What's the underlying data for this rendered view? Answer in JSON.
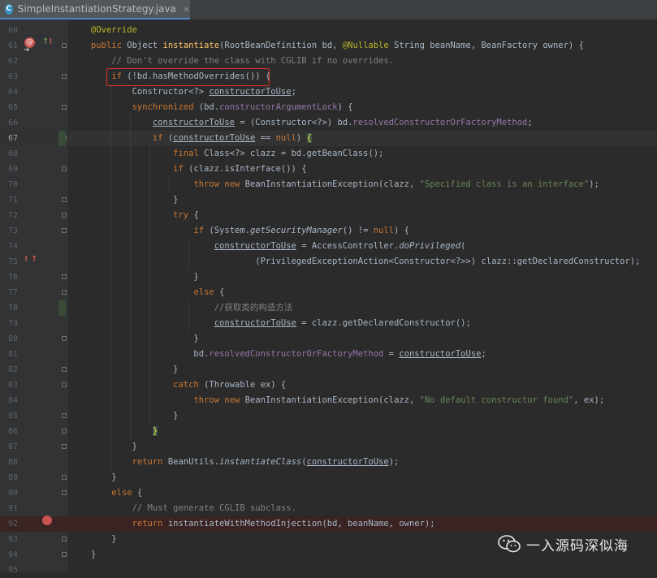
{
  "tab": {
    "icon_letter": "C",
    "file_name": "SimpleInstantiationStrategy.java",
    "close_glyph": "×"
  },
  "editor": {
    "caret_line": 67,
    "breakpoint_line": 92,
    "lines": [
      {
        "n": 60,
        "t": [
          {
            "c": "an",
            "v": "@Override"
          }
        ]
      },
      {
        "n": 61,
        "t": [
          {
            "c": "kw",
            "v": "public "
          },
          {
            "v": "Object "
          },
          {
            "c": "fn",
            "v": "instantiate"
          },
          {
            "v": "(RootBeanDefinition bd, "
          },
          {
            "c": "an",
            "v": "@Nullable "
          },
          {
            "v": "String beanName, BeanFactory owner) {"
          }
        ]
      },
      {
        "n": 62,
        "t": [
          {
            "v": "    "
          },
          {
            "c": "cm",
            "v": "// Don't override the class with CGLIB if no overrides."
          }
        ]
      },
      {
        "n": 63,
        "t": [
          {
            "v": "    "
          },
          {
            "c": "kw",
            "v": "if "
          },
          {
            "v": "(!bd.hasMethodOverrides()) {"
          }
        ]
      },
      {
        "n": 64,
        "t": [
          {
            "v": "        Constructor<?> "
          },
          {
            "c": "ul",
            "v": "constructorToUse"
          },
          {
            "v": ";"
          }
        ]
      },
      {
        "n": 65,
        "t": [
          {
            "v": "        "
          },
          {
            "c": "kw",
            "v": "synchronized "
          },
          {
            "v": "(bd."
          },
          {
            "c": "fd",
            "v": "constructorArgumentLock"
          },
          {
            "v": ") {"
          }
        ]
      },
      {
        "n": 66,
        "t": [
          {
            "v": "            "
          },
          {
            "c": "ul",
            "v": "constructorToUse"
          },
          {
            "v": " = (Constructor<?>) bd."
          },
          {
            "c": "fd",
            "v": "resolvedConstructorOrFactoryMethod"
          },
          {
            "v": ";"
          }
        ]
      },
      {
        "n": 67,
        "t": [
          {
            "v": "            "
          },
          {
            "c": "kw",
            "v": "if "
          },
          {
            "v": "("
          },
          {
            "c": "ul",
            "v": "constructorToUse"
          },
          {
            "v": " == "
          },
          {
            "c": "kw",
            "v": "null"
          },
          {
            "v": ") "
          },
          {
            "c": "brace",
            "v": "{"
          }
        ]
      },
      {
        "n": 68,
        "t": [
          {
            "v": "                "
          },
          {
            "c": "kw",
            "v": "final "
          },
          {
            "v": "Class<?> clazz = bd.getBeanClass();"
          }
        ]
      },
      {
        "n": 69,
        "t": [
          {
            "v": "                "
          },
          {
            "c": "kw",
            "v": "if "
          },
          {
            "v": "(clazz.isInterface()) {"
          }
        ]
      },
      {
        "n": 70,
        "t": [
          {
            "v": "                    "
          },
          {
            "c": "kw",
            "v": "throw new "
          },
          {
            "v": "BeanInstantiationException(clazz, "
          },
          {
            "c": "st",
            "v": "\"Specified class is an interface\""
          },
          {
            "v": ");"
          }
        ]
      },
      {
        "n": 71,
        "t": [
          {
            "v": "                }"
          }
        ]
      },
      {
        "n": 72,
        "t": [
          {
            "v": "                "
          },
          {
            "c": "kw",
            "v": "try "
          },
          {
            "v": "{"
          }
        ]
      },
      {
        "n": 73,
        "t": [
          {
            "v": "                    "
          },
          {
            "c": "kw",
            "v": "if "
          },
          {
            "v": "(System."
          },
          {
            "c": "it",
            "v": "getSecurityManager"
          },
          {
            "v": "() != "
          },
          {
            "c": "kw",
            "v": "null"
          },
          {
            "v": ") {"
          }
        ]
      },
      {
        "n": 74,
        "t": [
          {
            "v": "                        "
          },
          {
            "c": "ul",
            "v": "constructorToUse"
          },
          {
            "v": " = AccessController."
          },
          {
            "c": "it",
            "v": "doPrivileged"
          },
          {
            "v": "("
          }
        ]
      },
      {
        "n": 75,
        "t": [
          {
            "v": "                                (PrivilegedExceptionAction<Constructor<?>>) clazz::getDeclaredConstructor);"
          }
        ]
      },
      {
        "n": 76,
        "t": [
          {
            "v": "                    }"
          }
        ]
      },
      {
        "n": 77,
        "t": [
          {
            "v": "                    "
          },
          {
            "c": "kw",
            "v": "else "
          },
          {
            "v": "{"
          }
        ]
      },
      {
        "n": 78,
        "t": [
          {
            "v": "                        "
          },
          {
            "c": "cm",
            "v": "//获取类的构造方法"
          }
        ]
      },
      {
        "n": 79,
        "t": [
          {
            "v": "                        "
          },
          {
            "c": "ul",
            "v": "constructorToUse"
          },
          {
            "v": " = clazz.getDeclaredConstructor();"
          }
        ]
      },
      {
        "n": 80,
        "t": [
          {
            "v": "                    }"
          }
        ]
      },
      {
        "n": 81,
        "t": [
          {
            "v": "                    bd."
          },
          {
            "c": "fd",
            "v": "resolvedConstructorOrFactoryMethod"
          },
          {
            "v": " = "
          },
          {
            "c": "ul",
            "v": "constructorToUse"
          },
          {
            "v": ";"
          }
        ]
      },
      {
        "n": 82,
        "t": [
          {
            "v": "                }"
          }
        ]
      },
      {
        "n": 83,
        "t": [
          {
            "v": "                "
          },
          {
            "c": "kw",
            "v": "catch "
          },
          {
            "v": "(Throwable ex) {"
          }
        ]
      },
      {
        "n": 84,
        "t": [
          {
            "v": "                    "
          },
          {
            "c": "kw",
            "v": "throw new "
          },
          {
            "v": "BeanInstantiationException(clazz, "
          },
          {
            "c": "st",
            "v": "\"No default constructor found\""
          },
          {
            "v": ", ex);"
          }
        ]
      },
      {
        "n": 85,
        "t": [
          {
            "v": "                }"
          }
        ]
      },
      {
        "n": 86,
        "t": [
          {
            "v": "            "
          },
          {
            "c": "brace",
            "v": "}"
          }
        ]
      },
      {
        "n": 87,
        "t": [
          {
            "v": "        }"
          }
        ]
      },
      {
        "n": 88,
        "t": [
          {
            "v": "        "
          },
          {
            "c": "kw",
            "v": "return "
          },
          {
            "v": "BeanUtils."
          },
          {
            "c": "it",
            "v": "instantiateClass"
          },
          {
            "v": "("
          },
          {
            "c": "ul",
            "v": "constructorToUse"
          },
          {
            "v": ");"
          }
        ]
      },
      {
        "n": 89,
        "t": [
          {
            "v": "    }"
          }
        ]
      },
      {
        "n": 90,
        "t": [
          {
            "v": "    "
          },
          {
            "c": "kw",
            "v": "else "
          },
          {
            "v": "{"
          }
        ]
      },
      {
        "n": 91,
        "t": [
          {
            "v": "        "
          },
          {
            "c": "cm",
            "v": "// Must generate CGLIB subclass."
          }
        ]
      },
      {
        "n": 92,
        "t": [
          {
            "v": "        "
          },
          {
            "c": "kw",
            "v": "return "
          },
          {
            "v": "instantiateWithMethodInjection(bd, beanName, owner);"
          }
        ]
      },
      {
        "n": 93,
        "t": [
          {
            "v": "    }"
          }
        ]
      },
      {
        "n": 94,
        "t": [
          {
            "v": "}"
          }
        ]
      },
      {
        "n": 95,
        "t": []
      }
    ]
  },
  "gutter_icons": {
    "override": "@",
    "implement": "↑",
    "error_marker": "!"
  },
  "watermark": {
    "text": "一入源码深似海",
    "icon": "wechat-icon"
  }
}
